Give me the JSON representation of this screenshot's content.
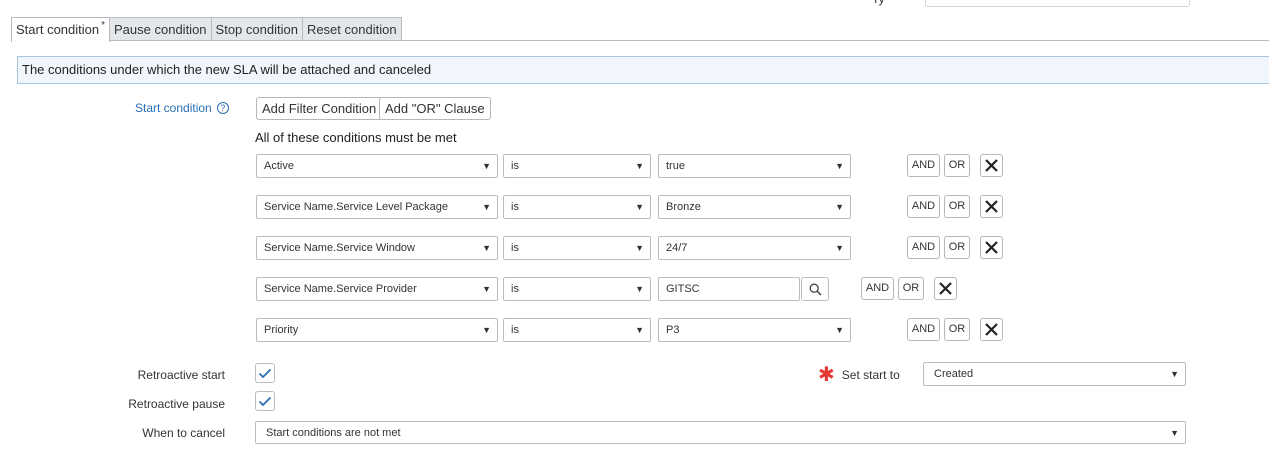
{
  "tabs": [
    {
      "label": "Start condition",
      "required_mark": "*",
      "active": true
    },
    {
      "label": "Pause condition"
    },
    {
      "label": "Stop condition"
    },
    {
      "label": "Reset condition"
    }
  ],
  "annotation": "The conditions under which the new SLA will be attached and canceled",
  "start_condition": {
    "label": "Start condition",
    "help_icon": "question-circle-icon",
    "add_filter_label": "Add Filter Condition",
    "add_or_label": "Add \"OR\" Clause",
    "all_met_text": "All of these conditions must be met",
    "rows": [
      {
        "field": "Active",
        "operator": "is",
        "value": "true"
      },
      {
        "field": "Service Name.Service Level Package",
        "operator": "is",
        "value": "Bronze"
      },
      {
        "field": "Service Name.Service Window",
        "operator": "is",
        "value": "24/7"
      },
      {
        "field": "Service Name.Service Provider",
        "operator": "is",
        "value": "GITSC"
      },
      {
        "field": "Priority",
        "operator": "is",
        "value": "P3"
      }
    ],
    "and_label": "AND",
    "or_label": "OR"
  },
  "retroactive_start": {
    "label": "Retroactive start",
    "checked": true
  },
  "retroactive_pause": {
    "label": "Retroactive pause",
    "checked": true
  },
  "set_start_to": {
    "label": "Set start to",
    "value": "Created",
    "required": true
  },
  "when_to_cancel": {
    "label": "When to cancel",
    "value": "Start conditions are not met"
  },
  "top_field": {
    "label": "Ty"
  },
  "colors": {
    "link": "#2b6fb3",
    "required": "#e53935",
    "check": "#2b6fb3",
    "annotation_bg": "#f0f6fb"
  }
}
